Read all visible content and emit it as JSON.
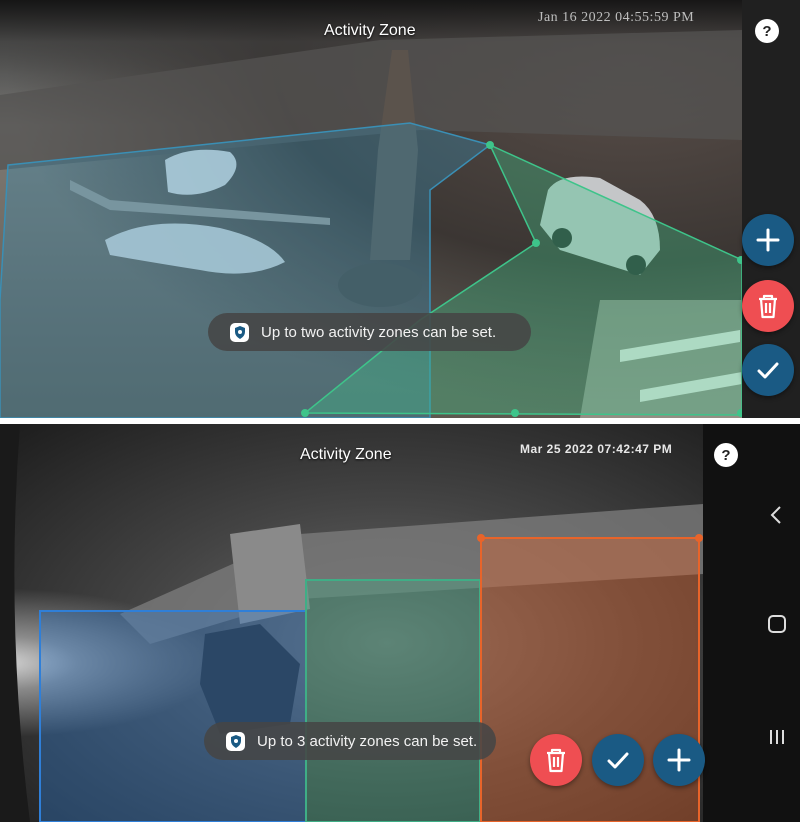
{
  "top_screen": {
    "title": "Activity Zone",
    "timestamp": "Jan 16 2022  04:55:59 PM",
    "toast": "Up to two activity zones can be set.",
    "colors": {
      "zone_1": "#3a8fb5",
      "zone_2": "#3ec48a",
      "fab": "#1a5a84",
      "delete": "#ef4e52"
    },
    "icons": [
      "question-icon",
      "shield-icon",
      "plus-icon",
      "trash-icon",
      "check-icon"
    ]
  },
  "bottom_screen": {
    "title": "Activity Zone",
    "timestamp": "Mar 25 2022 07:42:47 PM",
    "toast": "Up to 3 activity zones can be set.",
    "colors": {
      "zone_1": "#2f7fd8",
      "zone_2": "#3fae86",
      "zone_3": "#e8642a",
      "fab": "#1a5a84",
      "delete": "#ef4e52"
    },
    "icons": [
      "question-icon",
      "shield-icon",
      "trash-icon",
      "check-icon",
      "plus-icon",
      "back-icon",
      "home-icon",
      "recents-icon"
    ]
  },
  "help_label": "?"
}
